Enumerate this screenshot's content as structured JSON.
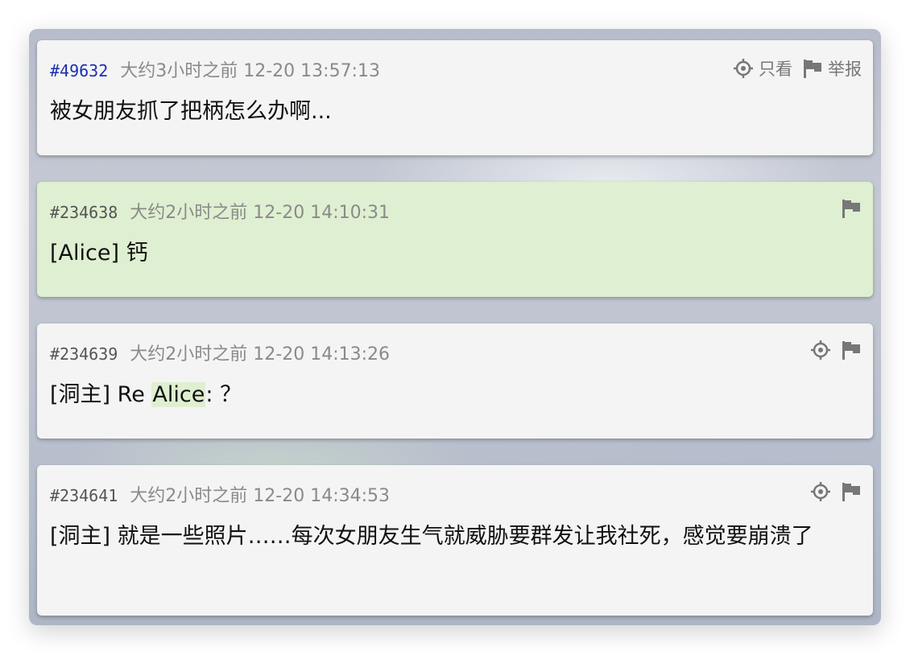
{
  "colors": {
    "card_bg": "#f4f4f4",
    "highlight_bg": "#dfefd1",
    "op_id": "#1a2fb0",
    "meta_text": "#8a8a8a",
    "icon": "#777777"
  },
  "posts": [
    {
      "id": "#49632",
      "time": "大约3小时之前 12-20 13:57:13",
      "body": "被女朋友抓了把柄怎么办啊...",
      "highlighted": false,
      "actions": {
        "view_only_label": "只看",
        "report_label": "举报"
      }
    },
    {
      "id": "#234638",
      "time": "大约2小时之前 12-20 14:10:31",
      "body": "[Alice] 钙",
      "highlighted": true
    },
    {
      "id": "#234639",
      "time": "大约2小时之前 12-20 14:13:26",
      "body_prefix": "[洞主] Re ",
      "body_mention": "Alice",
      "body_suffix": ": ？",
      "highlighted": false
    },
    {
      "id": "#234641",
      "time": "大约2小时之前 12-20 14:34:53",
      "body": "[洞主] 就是一些照片……每次女朋友生气就威胁要群发让我社死，感觉要崩溃了",
      "highlighted": false
    }
  ],
  "icons": {
    "view_only": "crosshair-icon",
    "report": "flag-icon"
  }
}
